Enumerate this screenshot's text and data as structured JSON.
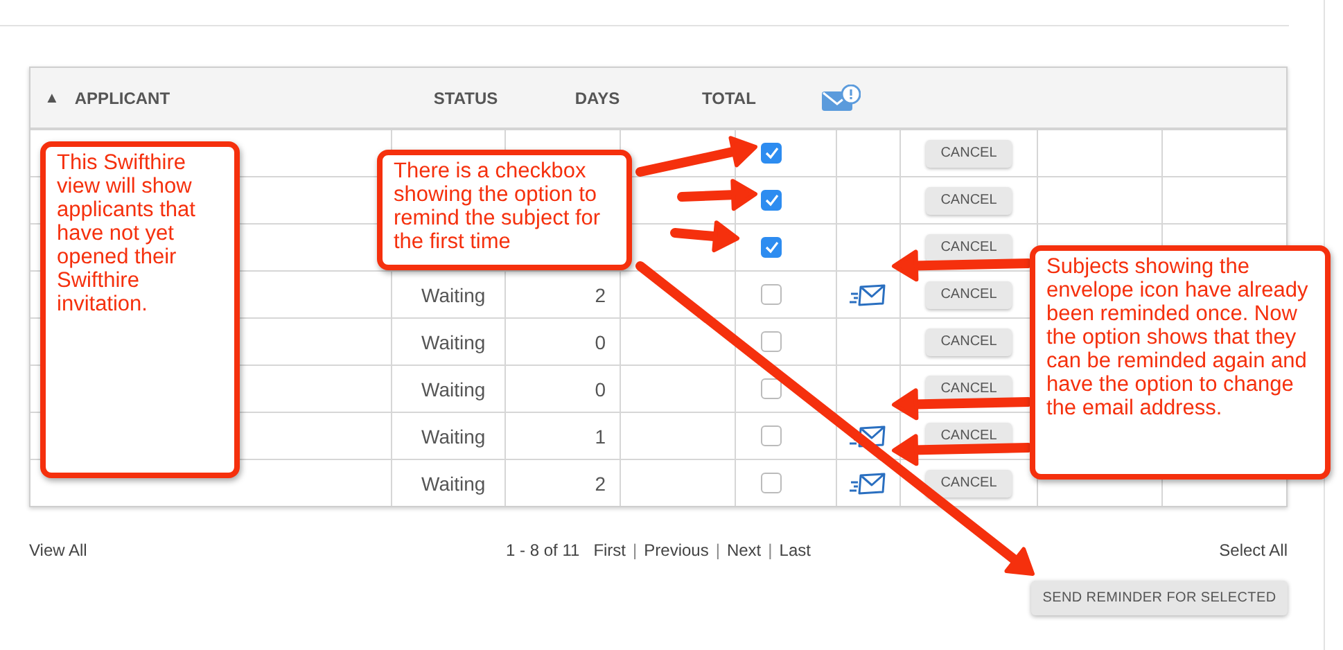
{
  "table": {
    "columns": [
      {
        "kind": "text",
        "label": "APPLICANT",
        "sort_indicator": "▲"
      },
      {
        "kind": "text",
        "label": "STATUS"
      },
      {
        "kind": "text",
        "label": "DAYS"
      },
      {
        "kind": "text",
        "label": "TOTAL"
      },
      {
        "kind": "icon"
      }
    ],
    "rows": [
      {
        "checked": true,
        "reminded": false,
        "action": "CANCEL"
      },
      {
        "checked": true,
        "reminded": false,
        "action": "CANCEL"
      },
      {
        "checked": true,
        "reminded": false,
        "action": "CANCEL"
      },
      {
        "status": "Waiting",
        "days": "2",
        "checked": false,
        "reminded": true,
        "action": "CANCEL"
      },
      {
        "status": "Waiting",
        "days": "0",
        "checked": false,
        "reminded": false,
        "action": "CANCEL"
      },
      {
        "status": "Waiting",
        "days": "0",
        "checked": false,
        "reminded": false,
        "action": "CANCEL"
      },
      {
        "status": "Waiting",
        "days": "1",
        "checked": false,
        "reminded": true,
        "action": "CANCEL"
      },
      {
        "status": "Waiting",
        "days": "2",
        "checked": false,
        "reminded": true,
        "action": "CANCEL"
      }
    ]
  },
  "footer": {
    "view_all": "View All",
    "range": "1 - 8 of 11",
    "links": [
      "First",
      "Previous",
      "Next",
      "Last"
    ],
    "separator": "|",
    "select_all": "Select All",
    "send_button": "SEND REMINDER FOR SELECTED"
  },
  "callouts": [
    {
      "text": "This Swifthire view will show applicants that have not yet opened their Swifthire invitation."
    },
    {
      "text": "There is a checkbox showing the option to remind the subject for the first time"
    },
    {
      "text": "Subjects showing the envelope icon have already been reminded once. Now the option shows that they can be reminded again and have the option to change the email address."
    }
  ]
}
